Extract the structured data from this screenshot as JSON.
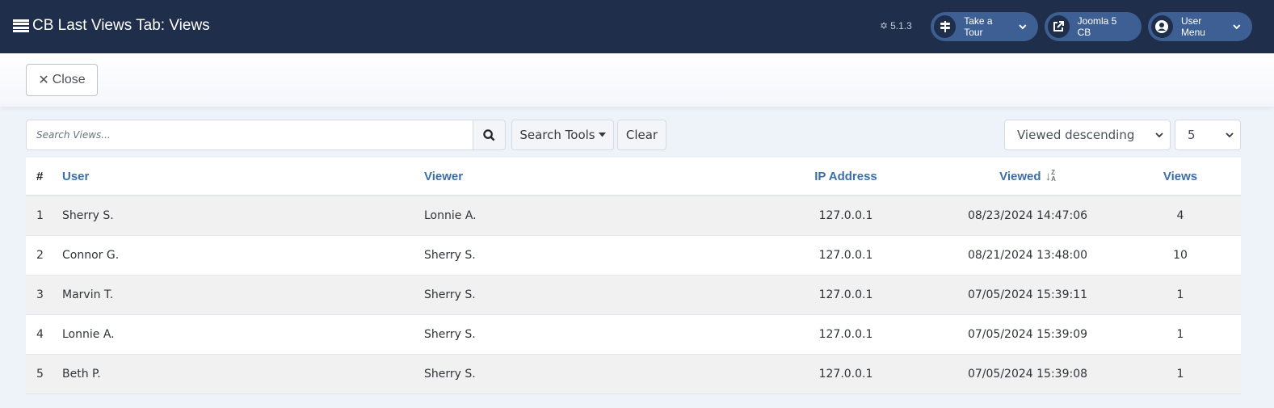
{
  "header": {
    "title": "CB Last Views Tab: Views",
    "title_icon": "list-icon",
    "version": "5.1.3",
    "version_icon": "joomla-icon",
    "buttons": [
      {
        "label": "Take a Tour",
        "icon": "signpost-icon",
        "has_dropdown": true
      },
      {
        "label": "Joomla 5 CB",
        "icon": "external-link-icon",
        "has_dropdown": false
      },
      {
        "label": "User Menu",
        "icon": "user-circle-icon",
        "has_dropdown": true
      }
    ]
  },
  "toolbar": {
    "close_label": "Close",
    "close_icon": "close-icon"
  },
  "filters": {
    "search_placeholder": "Search Views...",
    "search_value": "",
    "search_tools_label": "Search Tools",
    "clear_label": "Clear",
    "ordering_selected": "Viewed descending",
    "limit_selected": "5"
  },
  "table": {
    "headers": {
      "num": "#",
      "user": "User",
      "viewer": "Viewer",
      "ip": "IP Address",
      "viewed": "Viewed",
      "views": "Views"
    },
    "sorted_column": "viewed",
    "sort_direction": "descending",
    "rows": [
      {
        "num": "1",
        "user": "Sherry S.",
        "viewer": "Lonnie A.",
        "ip": "127.0.0.1",
        "viewed": "08/23/2024 14:47:06",
        "views": "4"
      },
      {
        "num": "2",
        "user": "Connor G.",
        "viewer": "Sherry S.",
        "ip": "127.0.0.1",
        "viewed": "08/21/2024 13:48:00",
        "views": "10"
      },
      {
        "num": "3",
        "user": "Marvin T.",
        "viewer": "Sherry S.",
        "ip": "127.0.0.1",
        "viewed": "07/05/2024 15:39:11",
        "views": "1"
      },
      {
        "num": "4",
        "user": "Lonnie A.",
        "viewer": "Sherry S.",
        "ip": "127.0.0.1",
        "viewed": "07/05/2024 15:39:09",
        "views": "1"
      },
      {
        "num": "5",
        "user": "Beth P.",
        "viewer": "Sherry S.",
        "ip": "127.0.0.1",
        "viewed": "07/05/2024 15:39:08",
        "views": "1"
      }
    ]
  },
  "colors": {
    "header_bg": "#1f2e4a",
    "pill_bg": "#3d5f93",
    "link_color": "#3c6ea8",
    "row_stripe": "#f1f1f1",
    "page_bg": "#eef2f9"
  }
}
